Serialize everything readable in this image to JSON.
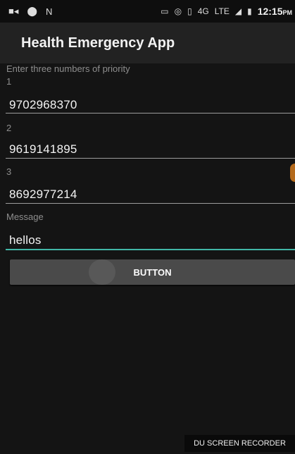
{
  "status_bar": {
    "time": "12:15",
    "ampm": "PM",
    "network_label": "4G",
    "lte_label": "LTE"
  },
  "app_bar": {
    "title": "Health Emergency App"
  },
  "form": {
    "instruction": "Enter three numbers of priority",
    "label_1": "1",
    "number_1": "9702968370",
    "label_2": "2",
    "number_2": "9619141895",
    "label_3": "3",
    "number_3": "8692977214",
    "message_label": "Message",
    "message_value": "hellos",
    "button_label": "BUTTON"
  },
  "watermark": "DU SCREEN RECORDER",
  "colors": {
    "accent": "#41b7a7",
    "background": "#141414",
    "button": "#4a4a4a"
  }
}
